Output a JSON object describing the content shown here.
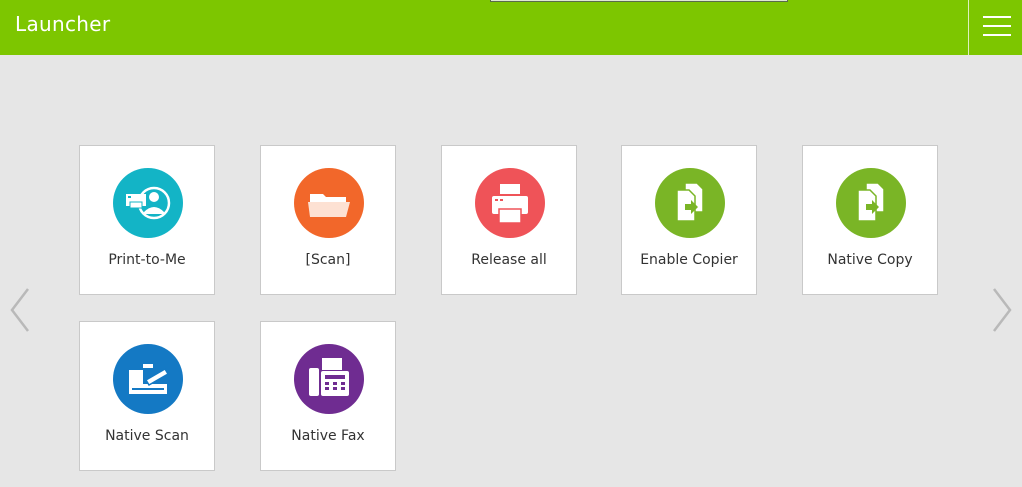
{
  "header": {
    "title": "Launcher"
  },
  "tiles": [
    {
      "label": "Print-to-Me",
      "icon": "print-to-me-icon",
      "color": "#13b4c6"
    },
    {
      "label": "[Scan]",
      "icon": "folder-icon",
      "color": "#f2672a"
    },
    {
      "label": "Release all",
      "icon": "printer-icon",
      "color": "#ef5358"
    },
    {
      "label": "Enable Copier",
      "icon": "copy-icon",
      "color": "#7ab526"
    },
    {
      "label": "Native Copy",
      "icon": "copy-icon",
      "color": "#7ab526"
    },
    {
      "label": "Native Scan",
      "icon": "scanner-icon",
      "color": "#1479c4"
    },
    {
      "label": "Native Fax",
      "icon": "fax-icon",
      "color": "#6f2c91"
    }
  ],
  "colors": {
    "header": "#7dc600",
    "background": "#e6e6e6"
  }
}
